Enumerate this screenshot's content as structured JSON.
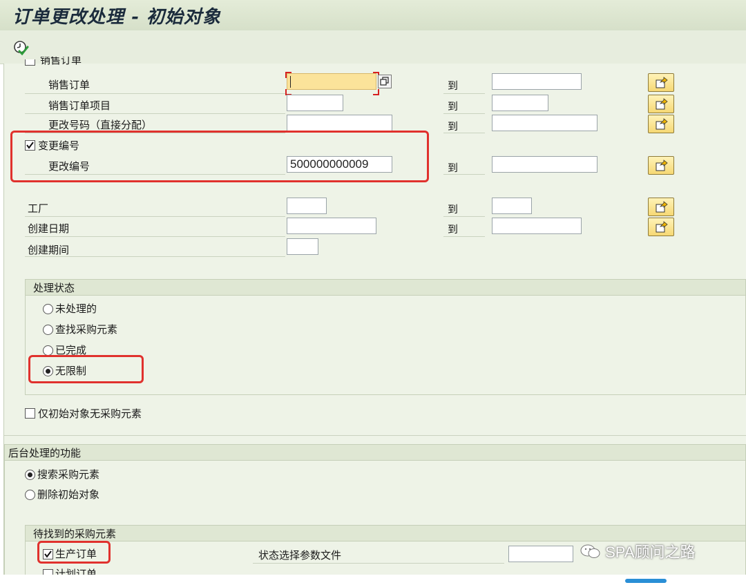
{
  "title": "订单更改处理 - 初始对象",
  "toolbar": {
    "execute_icon": "execute-clock-check-icon"
  },
  "selection": {
    "partial_header": "销售订单",
    "to_label": "到",
    "rows": [
      {
        "label": "销售订单",
        "value": "",
        "to_value": ""
      },
      {
        "label": "销售订单项目",
        "value": "",
        "to_value": ""
      },
      {
        "label": "更改号码（直接分配）",
        "value": "",
        "to_value": ""
      }
    ],
    "change_no_check_label": "变更编号",
    "change_no_label": "更改编号",
    "change_no_value": "500000000009",
    "change_no_to_value": "",
    "plant_label": "工厂",
    "created_date_label": "创建日期",
    "created_period_label": "创建期间"
  },
  "status_group": {
    "title": "处理状态",
    "options": [
      "未处理的",
      "查找采购元素",
      "已完成",
      "无限制"
    ],
    "selected": "无限制"
  },
  "only_initial_label": "仅初始对象无采购元素",
  "background_group": {
    "title": "后台处理的功能",
    "options": [
      "搜索采购元素",
      "删除初始对象"
    ],
    "selected": "搜索采购元素"
  },
  "elements_group": {
    "title": "待找到的采购元素",
    "production_order_label": "生产订单",
    "planned_order_label": "计划订单",
    "status_profile_label": "状态选择参数文件",
    "status_profile_value": ""
  },
  "watermark": "SPA顾问之路",
  "colors": {
    "highlight": "#e0312d",
    "focus_field": "#fbe39a",
    "background": "#eef3e7"
  }
}
